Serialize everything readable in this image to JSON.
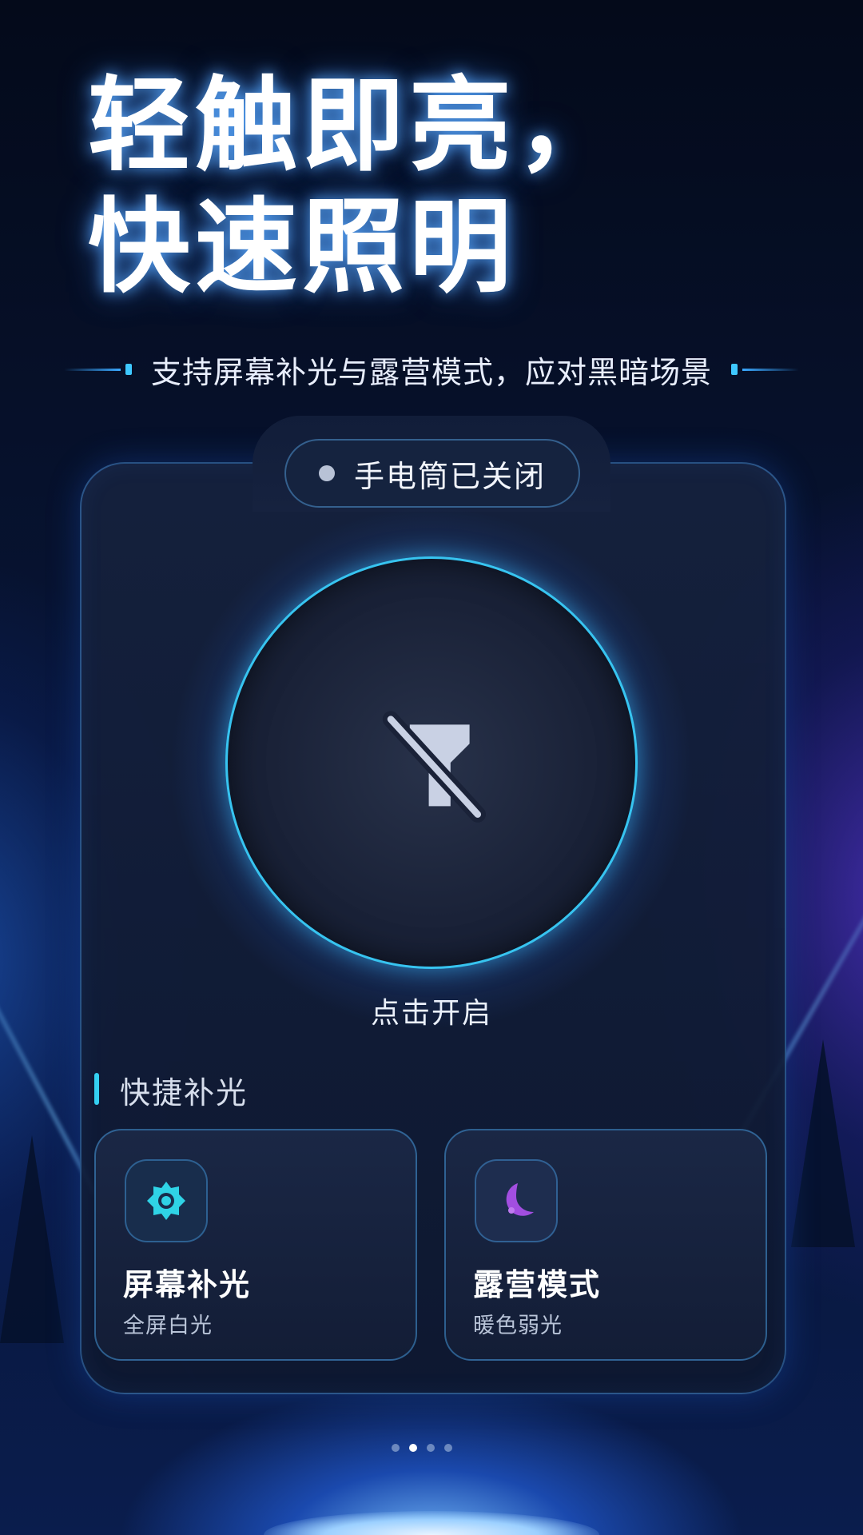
{
  "hero": {
    "line1": "轻触即亮，",
    "line2": "快速照明",
    "subtitle": "支持屏幕补光与露营模式，应对黑暗场景"
  },
  "status": {
    "label": "手电筒已关闭",
    "indicator": "off"
  },
  "power": {
    "icon": "flashlight-off-icon",
    "hint": "点击开启"
  },
  "quick": {
    "section_title": "快捷补光",
    "items": [
      {
        "icon": "sun-icon",
        "title": "屏幕补光",
        "subtitle": "全屏白光",
        "color": "#2fd3e6"
      },
      {
        "icon": "moon-icon",
        "title": "露营模式",
        "subtitle": "暖色弱光",
        "color": "#a24ee0"
      }
    ]
  },
  "pager": {
    "count": 4,
    "active_index": 1
  },
  "colors": {
    "accent": "#37c4f0",
    "background": "#071331",
    "card": "#16223f"
  }
}
